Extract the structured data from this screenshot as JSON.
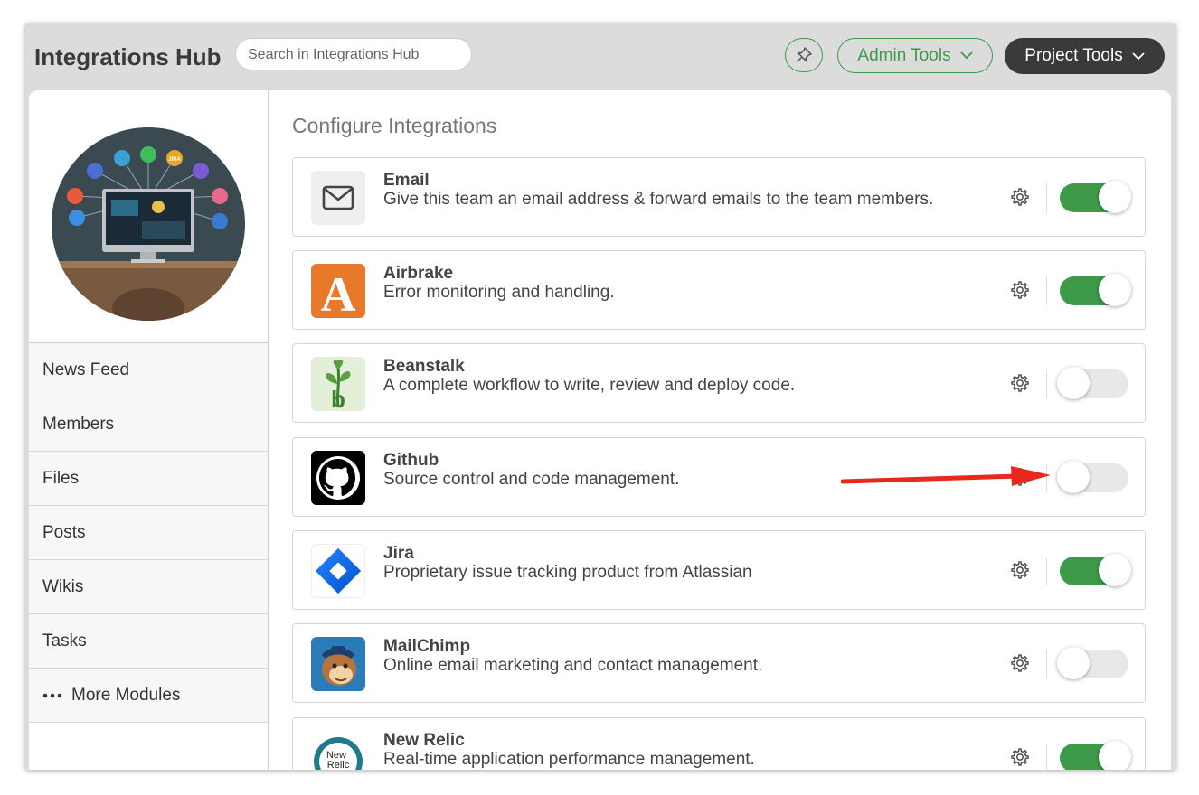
{
  "header": {
    "title": "Integrations Hub",
    "search_placeholder": "Search in Integrations Hub",
    "pin_icon": "pin-icon",
    "admin_tools": "Admin Tools",
    "project_tools": "Project Tools"
  },
  "sidebar": {
    "items": [
      {
        "label": "News Feed"
      },
      {
        "label": "Members"
      },
      {
        "label": "Files"
      },
      {
        "label": "Posts"
      },
      {
        "label": "Wikis"
      },
      {
        "label": "Tasks"
      },
      {
        "label": "More Modules",
        "icon": "dots-icon"
      }
    ]
  },
  "main": {
    "section_title": "Configure Integrations",
    "integrations": [
      {
        "name": "Email",
        "description": "Give this team an email address & forward emails to the team members.",
        "enabled": true,
        "logo": "email-icon"
      },
      {
        "name": "Airbrake",
        "description": "Error monitoring and handling.",
        "enabled": true,
        "logo": "airbrake-logo"
      },
      {
        "name": "Beanstalk",
        "description": "A complete workflow to write, review and deploy code.",
        "enabled": false,
        "logo": "beanstalk-logo"
      },
      {
        "name": "Github",
        "description": "Source control and code management.",
        "enabled": false,
        "logo": "github-logo"
      },
      {
        "name": "Jira",
        "description": "Proprietary issue tracking product from Atlassian",
        "enabled": true,
        "logo": "jira-logo"
      },
      {
        "name": "MailChimp",
        "description": "Online email marketing and contact management.",
        "enabled": false,
        "logo": "mailchimp-logo"
      },
      {
        "name": "New Relic",
        "description": "Real-time application performance management.",
        "enabled": true,
        "logo": "newrelic-logo"
      }
    ]
  },
  "logo_text": {
    "airbrake": "A",
    "beanstalk": "b",
    "newrelic_line1": "New",
    "newrelic_line2": "Relic"
  },
  "avatar_badges": {
    "jira": "JIRA"
  },
  "colors": {
    "accent_green": "#3a9d45",
    "toggle_on": "#3d9a48",
    "annotation_arrow": "#e8271d",
    "dark_button": "#3a3a3a"
  }
}
